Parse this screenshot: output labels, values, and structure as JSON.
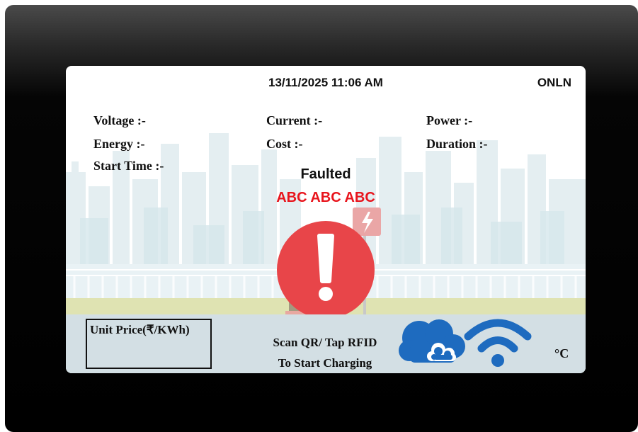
{
  "header": {
    "datetime": "13/11/2025 11:06 AM",
    "status": "ONLN"
  },
  "metrics": {
    "voltage": "Voltage :-",
    "current": "Current :-",
    "power": "Power :-",
    "energy": "Energy :-",
    "cost": "Cost :-",
    "duration": "Duration :-",
    "start_time": "Start Time :-"
  },
  "fault": {
    "status": "Faulted",
    "code": "ABC ABC ABC"
  },
  "footer": {
    "unit_price_label": "Unit Price(₹/KWh)",
    "scan_line1": "Scan QR/ Tap RFID",
    "scan_line2": "To Start Charging",
    "temperature_unit": "°C"
  },
  "icons": {
    "alert": "exclamation-circle-icon",
    "cloud": "cloud-icon",
    "wifi": "wifi-icon",
    "charger": "ev-charger-icon"
  },
  "colors": {
    "alert": "#e84549",
    "cloud_wifi": "#1e6bbf",
    "fault_code": "#e8141c",
    "bottom_bar": "#d3dfe4"
  }
}
